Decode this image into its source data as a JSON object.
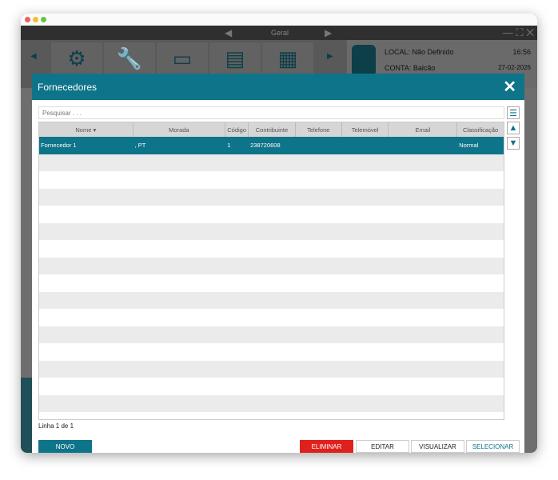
{
  "window": {
    "title": "Geral"
  },
  "header": {
    "local": "LOCAL: Não Definido",
    "conta": "CONTA: Balcão",
    "time": "16:56",
    "date": "27-02-2026"
  },
  "modal": {
    "title": "Fornecedores",
    "search_placeholder": "Pesquisar . . .",
    "columns": [
      "Nome ▾",
      "Morada",
      "Código",
      "Contribuinte",
      "Telefone",
      "Telemóvel",
      "Email",
      "Classificação"
    ],
    "rows": [
      [
        "Fornecedor 1",
        ", PT",
        "1",
        "238720608",
        "",
        "",
        "",
        "Normal"
      ]
    ],
    "status": "Linha 1 de 1",
    "buttons": {
      "novo": "NOVO",
      "eliminar": "ELIMINAR",
      "editar": "EDITAR",
      "visualizar": "VISUALIZAR",
      "selecionar": "SELECIONAR"
    }
  },
  "colors": {
    "accent": "#0e7489",
    "danger": "#e0201c"
  }
}
